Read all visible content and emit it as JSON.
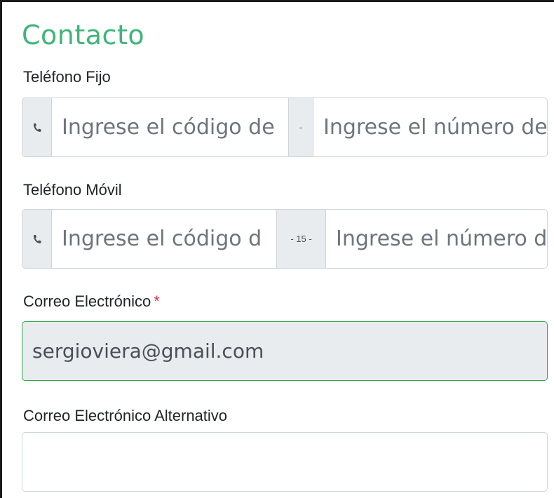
{
  "section": {
    "title": "Contacto"
  },
  "landline": {
    "label": "Teléfono Fijo",
    "phone_icon": "phone-icon",
    "area_code_placeholder": "Ingrese el código de",
    "separator": "-",
    "number_placeholder": "Ingrese el número de"
  },
  "mobile": {
    "label": "Teléfono Móvil",
    "phone_icon": "phone-icon",
    "area_code_placeholder": "Ingrese el código d",
    "separator": "- 15 -",
    "number_placeholder": "Ingrese el número d"
  },
  "email": {
    "label": "Correo Electrónico",
    "required_mark": "*",
    "value": "sergioviera@gmail.com",
    "valid_border_color": "#28a745"
  },
  "alt_email": {
    "label": "Correo Electrónico Alternativo",
    "value": ""
  },
  "colors": {
    "title": "#3fb57a",
    "required": "#dc3545",
    "addon_bg": "#e9ecef"
  }
}
